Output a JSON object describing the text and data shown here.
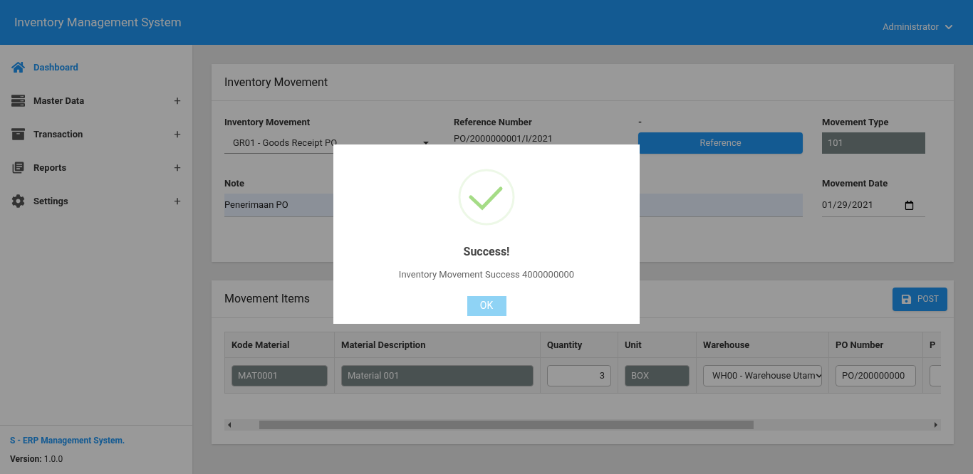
{
  "header": {
    "title": "Inventory Management System",
    "user": "Administrator"
  },
  "sidebar": {
    "items": [
      {
        "label": "Dashboard",
        "selected": true
      },
      {
        "label": "Master Data",
        "selected": false,
        "expander": "+"
      },
      {
        "label": "Transaction",
        "selected": false,
        "expander": "+"
      },
      {
        "label": "Reports",
        "selected": false,
        "expander": "+"
      },
      {
        "label": "Settings",
        "selected": false,
        "expander": "+"
      }
    ],
    "footer": {
      "brand": "S - ERP Management System.",
      "version_label": "Version:",
      "version": "1.0.0"
    }
  },
  "movement_card": {
    "title": "Inventory Movement",
    "fields": [
      {
        "kind": "select",
        "label": "Inventory Movement",
        "value": "GR01 - Goods Receipt PO"
      },
      {
        "kind": "text",
        "label": "Reference Number",
        "value": "PO/2000000001/I/2021"
      },
      {
        "kind": "button",
        "label": "-",
        "value": "Reference"
      },
      {
        "kind": "readonly",
        "label": "Movement Type",
        "value": "101"
      },
      {
        "kind": "wide",
        "label": "Note",
        "value": "Penerimaan PO"
      },
      {
        "kind": "date",
        "label": "Movement Date",
        "value": "01/29/2021"
      }
    ]
  },
  "items_card": {
    "title": "Movement Items",
    "post_button": "POST",
    "table": {
      "columns": [
        "Kode Material",
        "Material Description",
        "Quantity",
        "Unit",
        "Warehouse",
        "PO Number",
        "P"
      ],
      "rows": [
        {
          "cells": [
            {
              "kind": "readonly",
              "value": "MAT0001"
            },
            {
              "kind": "readonly",
              "value": "Material 001"
            },
            {
              "kind": "number",
              "value": "3"
            },
            {
              "kind": "readonly",
              "value": "BOX"
            },
            {
              "kind": "select",
              "value": "WH00 - Warehouse Utam"
            },
            {
              "kind": "text",
              "value": "PO/200000000"
            },
            {
              "kind": "text"
            }
          ]
        }
      ]
    }
  },
  "modal": {
    "title": "Success!",
    "message": "Inventory Movement Success 4000000000",
    "ok": "OK"
  }
}
